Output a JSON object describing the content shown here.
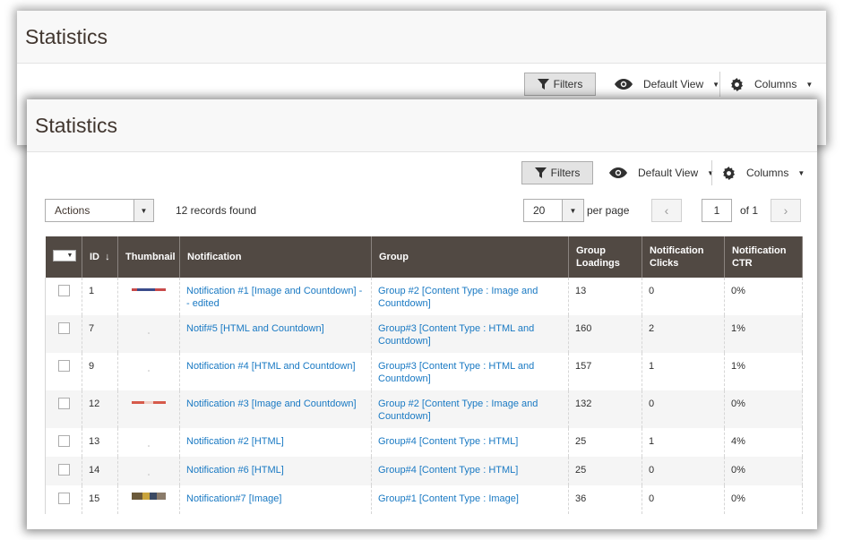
{
  "back_panel": {
    "title": "Statistics",
    "filters_label": "Filters",
    "view_label": "Default View",
    "columns_label": "Columns"
  },
  "front_panel": {
    "title": "Statistics",
    "filters_label": "Filters",
    "view_label": "Default View",
    "columns_label": "Columns"
  },
  "actions": {
    "label": "Actions"
  },
  "records_found": "12 records found",
  "pagination": {
    "per_page_value": "20",
    "per_page_label": "per page",
    "current_page": "1",
    "of_label": "of 1"
  },
  "icons": {
    "filter": "filter-icon",
    "view": "eye-icon",
    "columns": "gear-icon",
    "prev": "chevron-left-icon",
    "next": "chevron-right-icon"
  },
  "colors": {
    "header_bg": "#514943",
    "link": "#1979c3",
    "title": "#41362f"
  },
  "grid": {
    "columns": [
      {
        "key": "id",
        "label": "ID",
        "sort": "↓"
      },
      {
        "key": "thumbnail",
        "label": "Thumbnail"
      },
      {
        "key": "notification",
        "label": "Notification"
      },
      {
        "key": "group",
        "label": "Group"
      },
      {
        "key": "loadings",
        "label": "Group Loadings"
      },
      {
        "key": "clicks",
        "label": "Notification Clicks"
      },
      {
        "key": "ctr",
        "label": "Notification CTR"
      }
    ],
    "rows": [
      {
        "id": "1",
        "thumb": "red-strip",
        "notification": "Notification #1 [Image and Countdown] -- edited",
        "group": "Group #2 [Content Type : Image and Countdown]",
        "loadings": "13",
        "clicks": "0",
        "ctr": "0%"
      },
      {
        "id": "7",
        "thumb": "dot",
        "notification": "Notif#5 [HTML and Countdown]",
        "group": "Group#3 [Content Type : HTML and Countdown]",
        "loadings": "160",
        "clicks": "2",
        "ctr": "1%"
      },
      {
        "id": "9",
        "thumb": "dot",
        "notification": "Notification #4 [HTML and Countdown]",
        "group": "Group#3 [Content Type : HTML and Countdown]",
        "loadings": "157",
        "clicks": "1",
        "ctr": "1%"
      },
      {
        "id": "12",
        "thumb": "red-strip",
        "notification": "Notification #3 [Image and Countdown]",
        "group": "Group #2 [Content Type : Image and Countdown]",
        "loadings": "132",
        "clicks": "0",
        "ctr": "0%"
      },
      {
        "id": "13",
        "thumb": "dot",
        "notification": "Notification #2 [HTML]",
        "group": "Group#4 [Content Type : HTML]",
        "loadings": "25",
        "clicks": "1",
        "ctr": "4%"
      },
      {
        "id": "14",
        "thumb": "dot",
        "notification": "Notification #6 [HTML]",
        "group": "Group#4 [Content Type : HTML]",
        "loadings": "25",
        "clicks": "0",
        "ctr": "0%"
      },
      {
        "id": "15",
        "thumb": "image-strip",
        "notification": "Notification#7 [Image]",
        "group": "Group#1 [Content Type : Image]",
        "loadings": "36",
        "clicks": "0",
        "ctr": "0%"
      }
    ]
  }
}
